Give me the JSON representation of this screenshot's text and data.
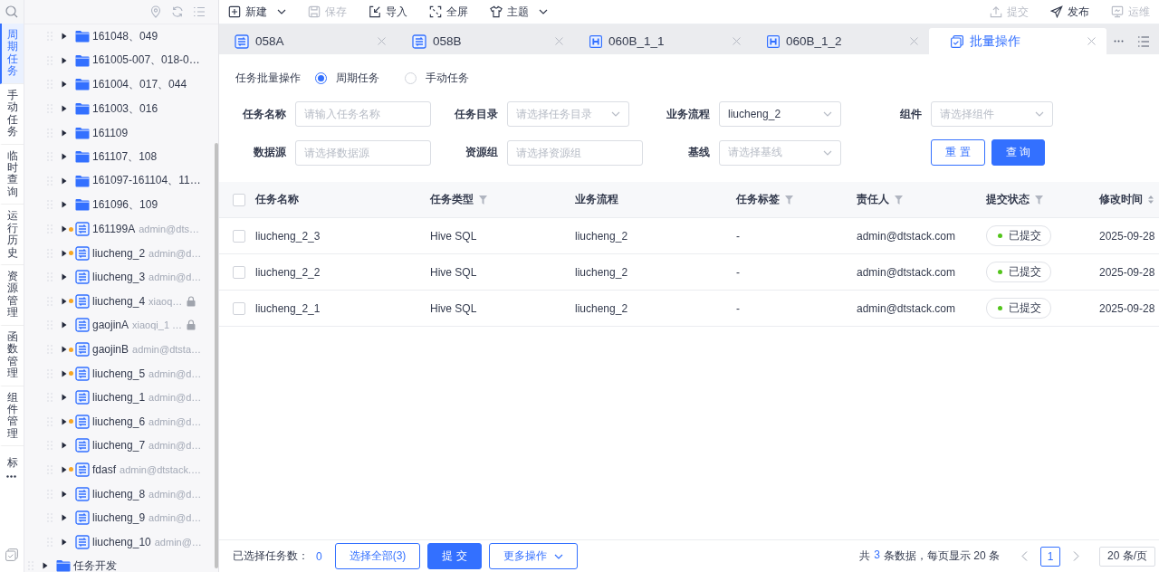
{
  "nav_rail": {
    "items": [
      {
        "label": "周期任务",
        "selected": true
      },
      {
        "label": "手动任务",
        "selected": false
      },
      {
        "label": "临时查询",
        "selected": false
      },
      {
        "label": "运行历史",
        "selected": false
      },
      {
        "label": "资源管理",
        "selected": false
      },
      {
        "label": "函数管理",
        "selected": false
      },
      {
        "label": "组件管理",
        "selected": false
      },
      {
        "label": "标",
        "selected": false
      }
    ]
  },
  "tree": {
    "items": [
      {
        "kind": "group",
        "children": [
          {
            "kind": "folder",
            "label": "161048、049",
            "changed": false,
            "locked": false
          },
          {
            "kind": "folder",
            "label": "161005-007、018-0…",
            "changed": false,
            "locked": false
          },
          {
            "kind": "folder",
            "label": "161004、017、044",
            "changed": false,
            "locked": false
          },
          {
            "kind": "folder",
            "label": "161003、016",
            "changed": false,
            "locked": false
          },
          {
            "kind": "folder",
            "label": "161109",
            "changed": false,
            "locked": false
          },
          {
            "kind": "folder",
            "label": "161107、108",
            "changed": false,
            "locked": false
          },
          {
            "kind": "folder",
            "label": "161097-161104、11…",
            "changed": false,
            "locked": false
          },
          {
            "kind": "folder",
            "label": "161096、109",
            "changed": false,
            "locked": false
          },
          {
            "kind": "flow",
            "label": "161199A",
            "owner": "admin@dts…",
            "changed": true,
            "locked": false
          },
          {
            "kind": "flow",
            "label": "liucheng_2",
            "owner": "admin@d…",
            "changed": true,
            "locked": false
          },
          {
            "kind": "flow",
            "label": "liucheng_3",
            "owner": "admin@d…",
            "changed": false,
            "locked": false
          },
          {
            "kind": "flow",
            "label": "liucheng_4",
            "owner": "xiaoq…",
            "changed": true,
            "locked": true
          },
          {
            "kind": "flow",
            "label": "gaojinA",
            "owner": "xiaoqi_1 …",
            "changed": false,
            "locked": true
          },
          {
            "kind": "flow",
            "label": "gaojinB",
            "owner": "admin@dtsta…",
            "changed": true,
            "locked": false
          },
          {
            "kind": "flow",
            "label": "liucheng_5",
            "owner": "admin@d…",
            "changed": true,
            "locked": false
          },
          {
            "kind": "flow",
            "label": "liucheng_1",
            "owner": "admin@d…",
            "changed": false,
            "locked": false
          },
          {
            "kind": "flow",
            "label": "liucheng_6",
            "owner": "admin@d…",
            "changed": true,
            "locked": false
          },
          {
            "kind": "flow",
            "label": "liucheng_7",
            "owner": "admin@d…",
            "changed": false,
            "locked": false
          },
          {
            "kind": "flow",
            "label": "fdasf",
            "owner": "admin@dtstack.…",
            "changed": true,
            "locked": false
          },
          {
            "kind": "flow",
            "label": "liucheng_8",
            "owner": "admin@d…",
            "changed": false,
            "locked": false
          },
          {
            "kind": "flow",
            "label": "liucheng_9",
            "owner": "admin@d…",
            "changed": false,
            "locked": false
          },
          {
            "kind": "flow",
            "label": "liucheng_10",
            "owner": "admin@…",
            "changed": false,
            "locked": false
          }
        ]
      },
      {
        "kind": "folder",
        "label": "任务开发",
        "changed": false,
        "locked": false
      }
    ]
  },
  "toolbar": {
    "left": [
      {
        "label": "新建",
        "disabled": false,
        "dropdown": true
      },
      {
        "label": "保存",
        "disabled": true,
        "dropdown": false
      },
      {
        "label": "导入",
        "disabled": false,
        "dropdown": false
      },
      {
        "label": "全屏",
        "disabled": false,
        "dropdown": false
      },
      {
        "label": "主题",
        "disabled": false,
        "dropdown": true
      }
    ],
    "right": [
      {
        "label": "提交",
        "disabled": true,
        "dropdown": false
      },
      {
        "label": "发布",
        "disabled": false,
        "dropdown": false
      },
      {
        "label": "运维",
        "disabled": true,
        "dropdown": false
      }
    ]
  },
  "tabs": [
    {
      "kind": "flow",
      "label": "058A",
      "selected": false
    },
    {
      "kind": "flow",
      "label": "058B",
      "selected": false
    },
    {
      "kind": "hive",
      "label": "060B_1_1",
      "selected": false
    },
    {
      "kind": "hive",
      "label": "060B_1_2",
      "selected": false
    },
    {
      "kind": "batch",
      "label": "批量操作",
      "selected": true
    }
  ],
  "form": {
    "mode_label": "任务批量操作",
    "modes": [
      {
        "label": "周期任务",
        "selected": true
      },
      {
        "label": "手动任务",
        "selected": false
      }
    ],
    "fields": [
      {
        "label": "任务名称",
        "kind": "input",
        "placeholder": "请输入任务名称"
      },
      {
        "label": "任务目录",
        "kind": "select",
        "placeholder": "请选择任务目录"
      },
      {
        "label": "业务流程",
        "kind": "select",
        "value": "liucheng_2"
      },
      {
        "label": "组件",
        "kind": "select",
        "placeholder": "请选择组件"
      },
      {
        "label": "数据源",
        "kind": "input",
        "placeholder": "请选择数据源"
      },
      {
        "label": "资源组",
        "kind": "input",
        "placeholder": "请选择资源组"
      },
      {
        "label": "基线",
        "kind": "select",
        "placeholder": "请选择基线"
      }
    ],
    "buttons": [
      {
        "label": "重 置",
        "kind": "secondary"
      },
      {
        "label": "查 询",
        "kind": "primary"
      }
    ]
  },
  "table": {
    "all_checked": false,
    "columns": [
      {
        "label": "任务名称",
        "filter": false,
        "sort": false
      },
      {
        "label": "任务类型",
        "filter": true,
        "sort": false
      },
      {
        "label": "业务流程",
        "filter": false,
        "sort": false
      },
      {
        "label": "任务标签",
        "filter": true,
        "sort": false
      },
      {
        "label": "责任人",
        "filter": true,
        "sort": false
      },
      {
        "label": "提交状态",
        "filter": true,
        "sort": false
      },
      {
        "label": "修改时间",
        "filter": false,
        "sort": true
      }
    ],
    "rows": [
      {
        "checked": false,
        "cells": [
          "liucheng_2_3",
          "Hive SQL",
          "liucheng_2",
          "-",
          "admin@dtstack.com"
        ],
        "status": "已提交",
        "color": "#52c41a",
        "time": "2025-09-28"
      },
      {
        "checked": false,
        "cells": [
          "liucheng_2_2",
          "Hive SQL",
          "liucheng_2",
          "-",
          "admin@dtstack.com"
        ],
        "status": "已提交",
        "color": "#52c41a",
        "time": "2025-09-28"
      },
      {
        "checked": false,
        "cells": [
          "liucheng_2_1",
          "Hive SQL",
          "liucheng_2",
          "-",
          "admin@dtstack.com"
        ],
        "status": "已提交",
        "color": "#52c41a",
        "time": "2025-09-28"
      }
    ]
  },
  "footer": {
    "selected_label": "已选择任务数：",
    "selected_count": "0",
    "buttons": [
      {
        "label": "选择全部(3)",
        "kind": "secondary",
        "dropdown": false
      },
      {
        "label": "提 交",
        "kind": "primary",
        "dropdown": false
      },
      {
        "label": "更多操作",
        "kind": "secondary",
        "dropdown": true
      }
    ],
    "total_prefix": "共",
    "total_count": "3",
    "total_suffix": "条数据，每页显示 20 条",
    "pages": [
      {
        "label": "1",
        "selected": true
      }
    ],
    "page_size": "20 条/页"
  }
}
